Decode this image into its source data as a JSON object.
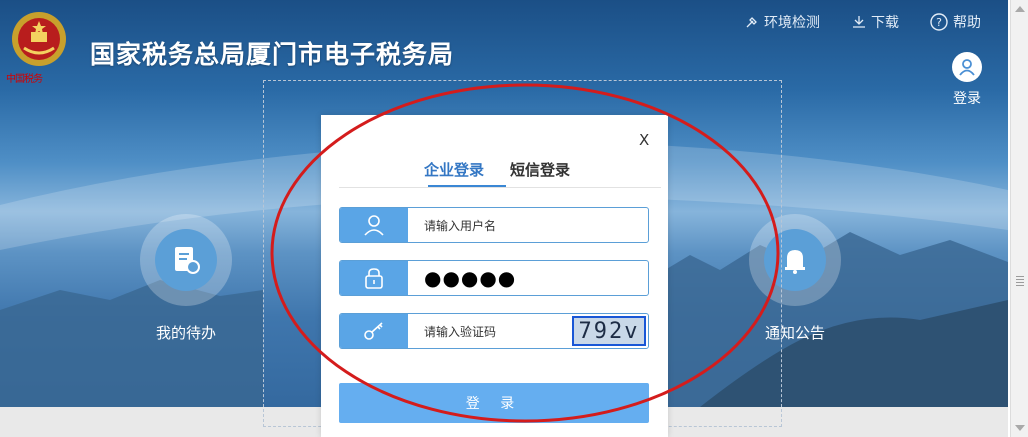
{
  "header": {
    "emblem_caption": "中国税务",
    "title": "国家税务总局厦门市电子税务局",
    "links": [
      {
        "label": "环境检测",
        "icon": "env-check-icon"
      },
      {
        "label": "下载",
        "icon": "download-icon"
      },
      {
        "label": "帮助",
        "icon": "help-icon"
      }
    ],
    "login_label": "登录"
  },
  "features": {
    "left_label": "我的待办",
    "right_label": "通知公告"
  },
  "modal": {
    "close_label": "X",
    "tabs": [
      "企业登录",
      "短信登录"
    ],
    "active_tab": 0,
    "username_placeholder": "请输入用户名",
    "password_value": "●●●●●",
    "captcha_placeholder": "请输入验证码",
    "captcha_text": "792v",
    "submit_label": "登 录"
  },
  "colors": {
    "accent": "#3a87d4",
    "field_icon_bg": "#5aa5e6",
    "button_bg": "#65aef0",
    "annotation_red": "#d41c1c"
  }
}
